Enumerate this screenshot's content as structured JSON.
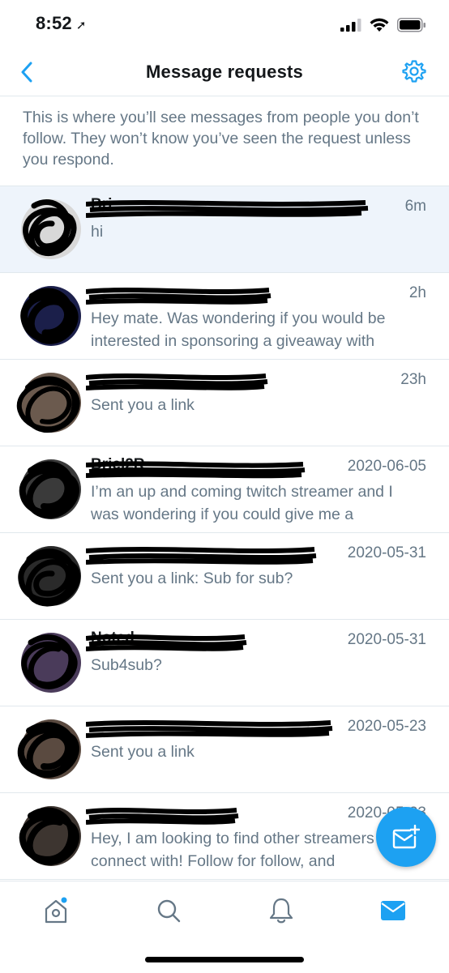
{
  "status_bar": {
    "time": "8:52",
    "battery": "full",
    "signal": "3 of 4 bars",
    "wifi": "connected"
  },
  "nav": {
    "title": "Message requests",
    "back_icon": "chevron-left-icon",
    "settings_icon": "gear-icon"
  },
  "intro_text": "This is where you’ll see messages from people you don’t follow. They won’t know you’ve seen the request unless you respond.",
  "requests": [
    {
      "name": "Bri",
      "time": "6m",
      "preview": "hi",
      "selected": true
    },
    {
      "name": "",
      "time": "2h",
      "preview": "Hey mate. Was wondering if you would be interested in sponsoring a giveaway with",
      "selected": false
    },
    {
      "name": "",
      "time": "23h",
      "preview": "Sent you a link",
      "selected": false
    },
    {
      "name": "Briel2R",
      "time": "2020-06-05",
      "preview": "I’m an up and coming twitch streamer and I was wondering if you could give me a",
      "selected": false
    },
    {
      "name": "",
      "time": "2020-05-31",
      "preview": "Sent you a link: Sub for sub?",
      "selected": false
    },
    {
      "name": "Noted",
      "time": "2020-05-31",
      "preview": "Sub4sub?",
      "selected": false
    },
    {
      "name": "",
      "time": "2020-05-23",
      "preview": "Sent you a link",
      "selected": false
    },
    {
      "name": "",
      "time": "2020-05-23",
      "preview": "Hey, I am looking to find other streamers to connect with! Follow for follow, and",
      "selected": false
    }
  ],
  "fab": {
    "icon": "new-message-icon"
  },
  "tabs": [
    {
      "name": "home",
      "icon": "home-icon",
      "active": false,
      "badge": true
    },
    {
      "name": "search",
      "icon": "search-icon",
      "active": false
    },
    {
      "name": "notifications",
      "icon": "bell-icon",
      "active": false
    },
    {
      "name": "messages",
      "icon": "envelope-icon",
      "active": true
    }
  ],
  "colors": {
    "accent": "#1da1f2",
    "text": "#14171a",
    "secondary": "#657786",
    "selected_row": "#eef4fb",
    "divider": "#e1e8ed"
  }
}
